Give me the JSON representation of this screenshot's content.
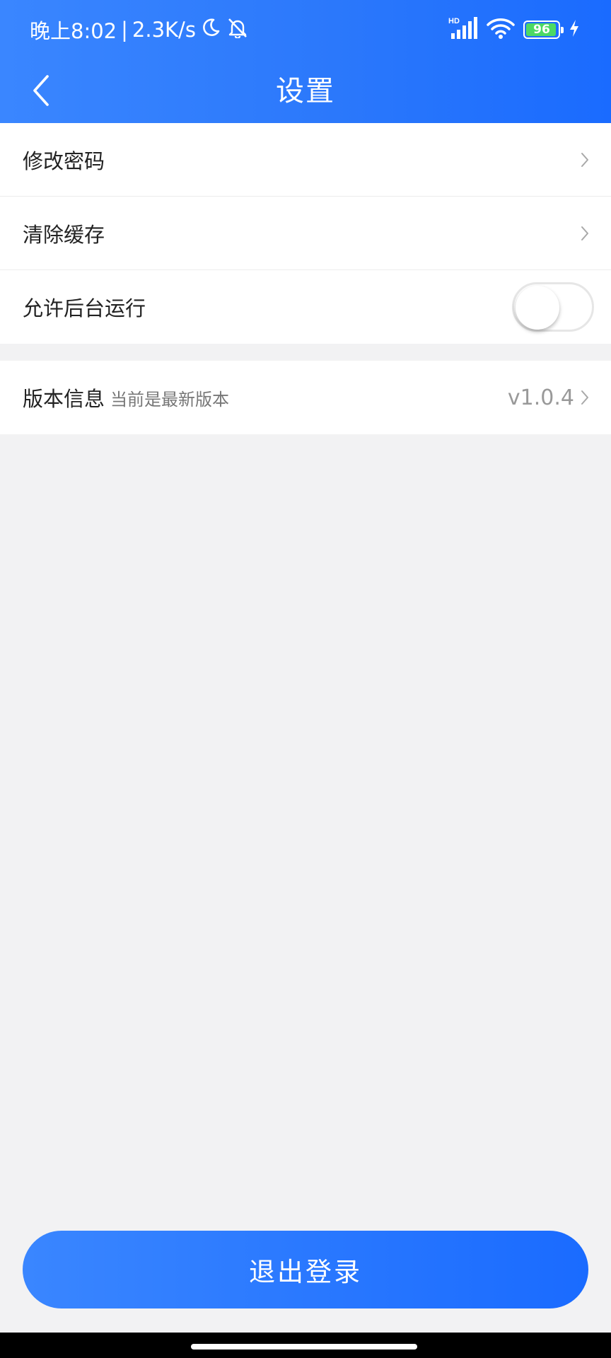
{
  "status_bar": {
    "time": "晚上8:02",
    "separator": "|",
    "network_speed": "2.3K/s",
    "icons_left": [
      "moon-icon",
      "bell-muted-icon"
    ],
    "signal_label": "HD",
    "icons_right": [
      "signal-icon",
      "wifi-icon",
      "charging-icon"
    ],
    "battery_level": "96",
    "battery_color": "#4cd964"
  },
  "nav": {
    "title": "设置",
    "back_icon": "chevron-left-icon"
  },
  "settings": {
    "change_password": {
      "label": "修改密码"
    },
    "clear_cache": {
      "label": "清除缓存"
    },
    "background_run": {
      "label": "允许后台运行",
      "enabled": false
    }
  },
  "version": {
    "label": "版本信息",
    "status": "当前是最新版本",
    "value": "v1.0.4"
  },
  "logout": {
    "label": "退出登录"
  },
  "colors": {
    "accent_start": "#3a86ff",
    "accent_end": "#1a6bff",
    "background": "#f2f2f3"
  }
}
